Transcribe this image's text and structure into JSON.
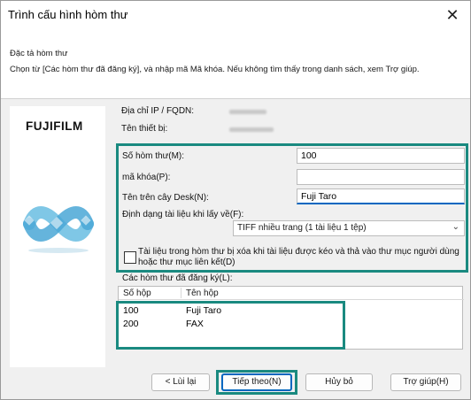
{
  "window": {
    "title": "Trình cấu hình hòm thư",
    "close": "✕"
  },
  "header": {
    "section_title": "Đặc tả hòm thư",
    "description": "Chọn từ [Các hòm thư đã đăng ký], và nhập mã Mã khóa. Nếu không tìm thấy trong danh sách, xem Trợ giúp."
  },
  "brand": {
    "logo_text": "FUJIFILM"
  },
  "device": {
    "ip_label": "Địa chỉ IP / FQDN:",
    "name_label": "Tên thiết bị:"
  },
  "form": {
    "mailbox_no_label": "Số hòm thư(M):",
    "mailbox_no_value": "100",
    "passcode_label": "mã khóa(P):",
    "passcode_value": "",
    "desk_name_label": "Tên trên cây Desk(N):",
    "desk_name_value": "Fuji Taro",
    "format_label": "Định dạng tài liệu khi lấy về(F):",
    "format_selected": "TIFF nhiều trang (1 tài liệu 1 tệp)",
    "delete_checkbox_label": "Tài liệu trong hòm thư bị xóa khi tài liệu được kéo và thả vào thư mục người dùng hoặc thư mục liên kết(D)",
    "delete_checked": false
  },
  "registered": {
    "label": "Các hòm thư đã đăng ký(L):",
    "columns": [
      "Số hộp",
      "Tên hộp"
    ],
    "rows": [
      {
        "number": "100",
        "name": "Fuji Taro"
      },
      {
        "number": "200",
        "name": "FAX"
      }
    ]
  },
  "buttons": {
    "back": "< Lùi lại",
    "next": "Tiếp theo(N)",
    "cancel": "Hủy bỏ",
    "help": "Trợ giúp(H)"
  },
  "colors": {
    "highlight": "#1a8a80",
    "focus": "#0067c0"
  }
}
